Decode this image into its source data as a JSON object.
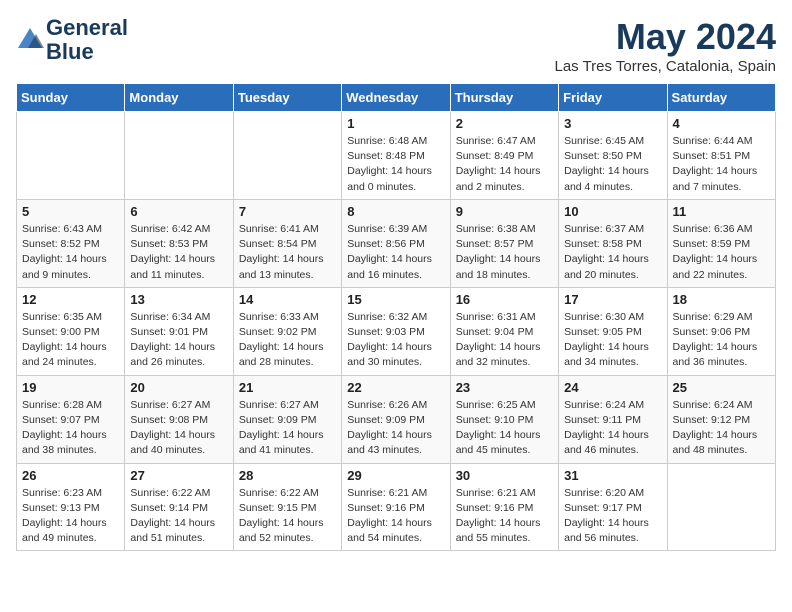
{
  "header": {
    "logo_line1": "General",
    "logo_line2": "Blue",
    "month_title": "May 2024",
    "location": "Las Tres Torres, Catalonia, Spain"
  },
  "weekdays": [
    "Sunday",
    "Monday",
    "Tuesday",
    "Wednesday",
    "Thursday",
    "Friday",
    "Saturday"
  ],
  "weeks": [
    [
      {
        "day": "",
        "info": ""
      },
      {
        "day": "",
        "info": ""
      },
      {
        "day": "",
        "info": ""
      },
      {
        "day": "1",
        "info": "Sunrise: 6:48 AM\nSunset: 8:48 PM\nDaylight: 14 hours\nand 0 minutes."
      },
      {
        "day": "2",
        "info": "Sunrise: 6:47 AM\nSunset: 8:49 PM\nDaylight: 14 hours\nand 2 minutes."
      },
      {
        "day": "3",
        "info": "Sunrise: 6:45 AM\nSunset: 8:50 PM\nDaylight: 14 hours\nand 4 minutes."
      },
      {
        "day": "4",
        "info": "Sunrise: 6:44 AM\nSunset: 8:51 PM\nDaylight: 14 hours\nand 7 minutes."
      }
    ],
    [
      {
        "day": "5",
        "info": "Sunrise: 6:43 AM\nSunset: 8:52 PM\nDaylight: 14 hours\nand 9 minutes."
      },
      {
        "day": "6",
        "info": "Sunrise: 6:42 AM\nSunset: 8:53 PM\nDaylight: 14 hours\nand 11 minutes."
      },
      {
        "day": "7",
        "info": "Sunrise: 6:41 AM\nSunset: 8:54 PM\nDaylight: 14 hours\nand 13 minutes."
      },
      {
        "day": "8",
        "info": "Sunrise: 6:39 AM\nSunset: 8:56 PM\nDaylight: 14 hours\nand 16 minutes."
      },
      {
        "day": "9",
        "info": "Sunrise: 6:38 AM\nSunset: 8:57 PM\nDaylight: 14 hours\nand 18 minutes."
      },
      {
        "day": "10",
        "info": "Sunrise: 6:37 AM\nSunset: 8:58 PM\nDaylight: 14 hours\nand 20 minutes."
      },
      {
        "day": "11",
        "info": "Sunrise: 6:36 AM\nSunset: 8:59 PM\nDaylight: 14 hours\nand 22 minutes."
      }
    ],
    [
      {
        "day": "12",
        "info": "Sunrise: 6:35 AM\nSunset: 9:00 PM\nDaylight: 14 hours\nand 24 minutes."
      },
      {
        "day": "13",
        "info": "Sunrise: 6:34 AM\nSunset: 9:01 PM\nDaylight: 14 hours\nand 26 minutes."
      },
      {
        "day": "14",
        "info": "Sunrise: 6:33 AM\nSunset: 9:02 PM\nDaylight: 14 hours\nand 28 minutes."
      },
      {
        "day": "15",
        "info": "Sunrise: 6:32 AM\nSunset: 9:03 PM\nDaylight: 14 hours\nand 30 minutes."
      },
      {
        "day": "16",
        "info": "Sunrise: 6:31 AM\nSunset: 9:04 PM\nDaylight: 14 hours\nand 32 minutes."
      },
      {
        "day": "17",
        "info": "Sunrise: 6:30 AM\nSunset: 9:05 PM\nDaylight: 14 hours\nand 34 minutes."
      },
      {
        "day": "18",
        "info": "Sunrise: 6:29 AM\nSunset: 9:06 PM\nDaylight: 14 hours\nand 36 minutes."
      }
    ],
    [
      {
        "day": "19",
        "info": "Sunrise: 6:28 AM\nSunset: 9:07 PM\nDaylight: 14 hours\nand 38 minutes."
      },
      {
        "day": "20",
        "info": "Sunrise: 6:27 AM\nSunset: 9:08 PM\nDaylight: 14 hours\nand 40 minutes."
      },
      {
        "day": "21",
        "info": "Sunrise: 6:27 AM\nSunset: 9:09 PM\nDaylight: 14 hours\nand 41 minutes."
      },
      {
        "day": "22",
        "info": "Sunrise: 6:26 AM\nSunset: 9:09 PM\nDaylight: 14 hours\nand 43 minutes."
      },
      {
        "day": "23",
        "info": "Sunrise: 6:25 AM\nSunset: 9:10 PM\nDaylight: 14 hours\nand 45 minutes."
      },
      {
        "day": "24",
        "info": "Sunrise: 6:24 AM\nSunset: 9:11 PM\nDaylight: 14 hours\nand 46 minutes."
      },
      {
        "day": "25",
        "info": "Sunrise: 6:24 AM\nSunset: 9:12 PM\nDaylight: 14 hours\nand 48 minutes."
      }
    ],
    [
      {
        "day": "26",
        "info": "Sunrise: 6:23 AM\nSunset: 9:13 PM\nDaylight: 14 hours\nand 49 minutes."
      },
      {
        "day": "27",
        "info": "Sunrise: 6:22 AM\nSunset: 9:14 PM\nDaylight: 14 hours\nand 51 minutes."
      },
      {
        "day": "28",
        "info": "Sunrise: 6:22 AM\nSunset: 9:15 PM\nDaylight: 14 hours\nand 52 minutes."
      },
      {
        "day": "29",
        "info": "Sunrise: 6:21 AM\nSunset: 9:16 PM\nDaylight: 14 hours\nand 54 minutes."
      },
      {
        "day": "30",
        "info": "Sunrise: 6:21 AM\nSunset: 9:16 PM\nDaylight: 14 hours\nand 55 minutes."
      },
      {
        "day": "31",
        "info": "Sunrise: 6:20 AM\nSunset: 9:17 PM\nDaylight: 14 hours\nand 56 minutes."
      },
      {
        "day": "",
        "info": ""
      }
    ]
  ]
}
